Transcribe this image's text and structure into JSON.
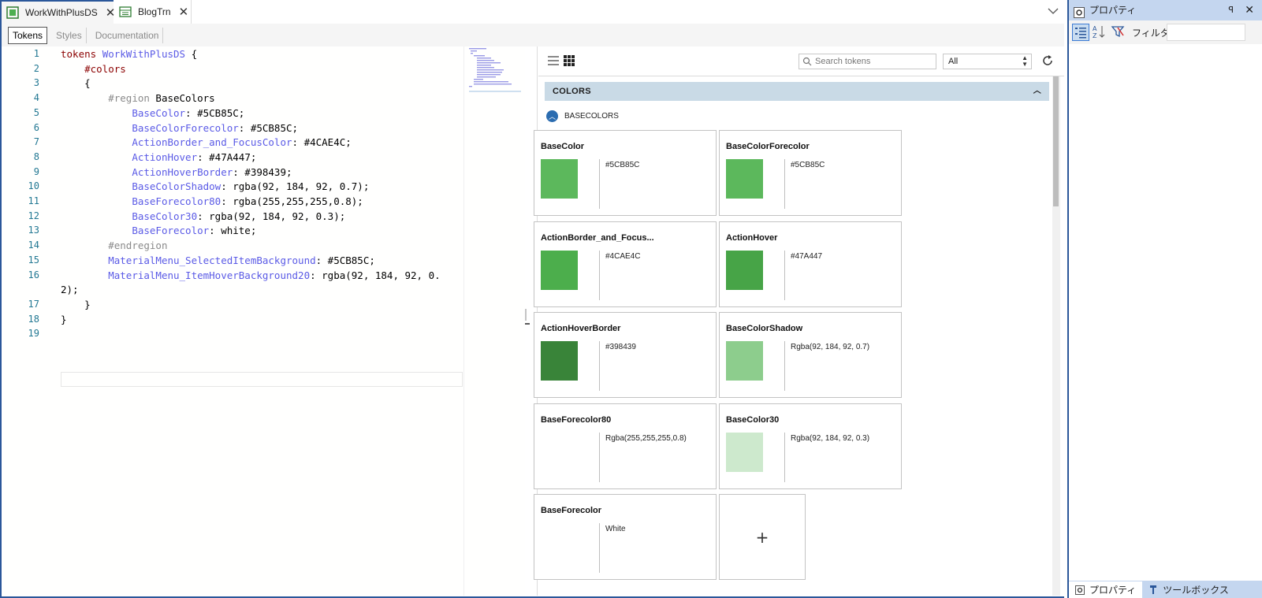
{
  "tabs": [
    {
      "label": "WorkWithPlusDS",
      "active": true,
      "icon": "design-system-icon"
    },
    {
      "label": "BlogTrn",
      "active": false,
      "icon": "transaction-icon"
    }
  ],
  "subtabs": [
    "Tokens",
    "Styles",
    "Documentation"
  ],
  "editor": {
    "line_numbers": [
      "1",
      "2",
      "3",
      "4",
      "5",
      "6",
      "7",
      "8",
      "9",
      "10",
      "11",
      "12",
      "13",
      "14",
      "15",
      "16",
      "17",
      "18",
      "19"
    ],
    "lines": [
      {
        "parts": [
          {
            "t": "tokens ",
            "c": "kw"
          },
          {
            "t": "WorkWithPlusDS",
            "c": "nm"
          },
          {
            "t": " {",
            "c": "pl"
          }
        ]
      },
      {
        "parts": [
          {
            "t": "    ",
            "c": "pl"
          },
          {
            "t": "#colors",
            "c": "kw"
          }
        ]
      },
      {
        "parts": [
          {
            "t": "    {",
            "c": "pl"
          }
        ]
      },
      {
        "parts": [
          {
            "t": "        ",
            "c": "pl"
          },
          {
            "t": "#region",
            "c": "rg"
          },
          {
            "t": " BaseColors",
            "c": "pl"
          }
        ]
      },
      {
        "parts": [
          {
            "t": "            ",
            "c": "pl"
          },
          {
            "t": "BaseColor",
            "c": "nm"
          },
          {
            "t": ": #5CB85C;",
            "c": "pl"
          }
        ]
      },
      {
        "parts": [
          {
            "t": "            ",
            "c": "pl"
          },
          {
            "t": "BaseColorForecolor",
            "c": "nm"
          },
          {
            "t": ": #5CB85C;",
            "c": "pl"
          }
        ]
      },
      {
        "parts": [
          {
            "t": "            ",
            "c": "pl"
          },
          {
            "t": "ActionBorder_and_FocusColor",
            "c": "nm"
          },
          {
            "t": ": #4CAE4C;",
            "c": "pl"
          }
        ]
      },
      {
        "parts": [
          {
            "t": "            ",
            "c": "pl"
          },
          {
            "t": "ActionHover",
            "c": "nm"
          },
          {
            "t": ": #47A447;",
            "c": "pl"
          }
        ]
      },
      {
        "parts": [
          {
            "t": "            ",
            "c": "pl"
          },
          {
            "t": "ActionHoverBorder",
            "c": "nm"
          },
          {
            "t": ": #398439;",
            "c": "pl"
          }
        ]
      },
      {
        "parts": [
          {
            "t": "            ",
            "c": "pl"
          },
          {
            "t": "BaseColorShadow",
            "c": "nm"
          },
          {
            "t": ": rgba(92, 184, 92, 0.7);",
            "c": "pl"
          }
        ]
      },
      {
        "parts": [
          {
            "t": "            ",
            "c": "pl"
          },
          {
            "t": "BaseForecolor80",
            "c": "nm"
          },
          {
            "t": ": rgba(255,255,255,0.8);",
            "c": "pl"
          }
        ]
      },
      {
        "parts": [
          {
            "t": "            ",
            "c": "pl"
          },
          {
            "t": "BaseColor30",
            "c": "nm"
          },
          {
            "t": ": rgba(92, 184, 92, 0.3);",
            "c": "pl"
          }
        ]
      },
      {
        "parts": [
          {
            "t": "            ",
            "c": "pl"
          },
          {
            "t": "BaseForecolor",
            "c": "nm"
          },
          {
            "t": ": white;",
            "c": "pl"
          }
        ]
      },
      {
        "parts": [
          {
            "t": "        ",
            "c": "pl"
          },
          {
            "t": "#endregion",
            "c": "rg"
          }
        ]
      },
      {
        "parts": [
          {
            "t": "        ",
            "c": "pl"
          },
          {
            "t": "MaterialMenu_SelectedItemBackground",
            "c": "nm"
          },
          {
            "t": ": #5CB85C;",
            "c": "pl"
          }
        ]
      },
      {
        "parts": [
          {
            "t": "        ",
            "c": "pl"
          },
          {
            "t": "MaterialMenu_ItemHoverBackground20",
            "c": "nm"
          },
          {
            "t": ": rgba(92, 184, 92, 0.",
            "c": "pl"
          }
        ]
      },
      {
        "parts": [
          {
            "t": "2);",
            "c": "pl"
          }
        ]
      },
      {
        "parts": [
          {
            "t": "    }",
            "c": "pl"
          }
        ]
      },
      {
        "parts": [
          {
            "t": "}",
            "c": "pl"
          }
        ]
      },
      {
        "parts": [
          {
            "t": "",
            "c": "pl"
          }
        ]
      }
    ]
  },
  "tokens_panel": {
    "search_placeholder": "Search tokens",
    "filter_value": "All",
    "section_title": "COLORS",
    "group_title": "BASECOLORS",
    "add_label": "+",
    "cards": [
      {
        "name": "BaseColor",
        "value": "#5CB85C",
        "swatch": "#5CB85C"
      },
      {
        "name": "BaseColorForecolor",
        "value": "#5CB85C",
        "swatch": "#5CB85C"
      },
      {
        "name": "ActionBorder_and_Focus...",
        "value": "#4CAE4C",
        "swatch": "#4CAE4C"
      },
      {
        "name": "ActionHover",
        "value": "#47A447",
        "swatch": "#47A447"
      },
      {
        "name": "ActionHoverBorder",
        "value": "#398439",
        "swatch": "#398439"
      },
      {
        "name": "BaseColorShadow",
        "value": "Rgba(92, 184, 92, 0.7)",
        "swatch": "#8dcd8d"
      },
      {
        "name": "BaseForecolor80",
        "value": "Rgba(255,255,255,0.8)",
        "swatch": "#ffffff"
      },
      {
        "name": "BaseColor30",
        "value": "Rgba(92, 184, 92, 0.3)",
        "swatch": "#cde9cd"
      },
      {
        "name": "BaseForecolor",
        "value": "White",
        "swatch": "#ffffff"
      }
    ]
  },
  "properties": {
    "title": "プロパティ",
    "pin": "ꟼ",
    "close": "✕",
    "filter_label": "フィルタ",
    "bottom_tabs": [
      {
        "label": "プロパティ",
        "active": true
      },
      {
        "label": "ツールボックス",
        "active": false
      }
    ]
  },
  "colors": {
    "accent": "#2b579a",
    "pane_header": "#c4d6ef",
    "section_header": "#c9dae6"
  }
}
